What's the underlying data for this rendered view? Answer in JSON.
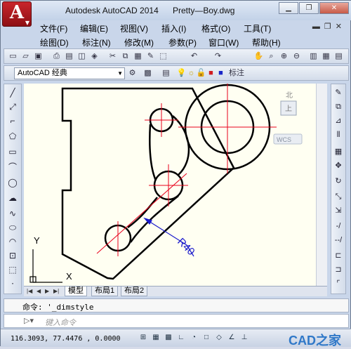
{
  "app": {
    "title": "Autodesk AutoCAD 2014",
    "filename": "Pretty—Boy.dwg",
    "logo_letter": "A"
  },
  "menu_row1": [
    "文件(F)",
    "编辑(E)",
    "视图(V)",
    "插入(I)",
    "格式(O)",
    "工具(T)"
  ],
  "menu_row2": [
    "绘图(D)",
    "标注(N)",
    "修改(M)",
    "参数(P)",
    "窗口(W)",
    "帮助(H)"
  ],
  "toolbar2": {
    "workspace": "AutoCAD 经典",
    "dimstyle": "标注"
  },
  "viewcube": {
    "north": "北",
    "top": "上",
    "wcs": "WCS"
  },
  "ucs": {
    "x_label": "X",
    "y_label": "Y"
  },
  "dimension": {
    "label": "R40"
  },
  "layout_tabs": [
    "模型",
    "布局1",
    "布局2"
  ],
  "command": {
    "history": "命令: '_dimstyle",
    "placeholder": "键入命令"
  },
  "status": {
    "coords": "116.3093, 77.4476 , 0.0000",
    "watermark": "CAD之家"
  },
  "colors": {
    "geometry": "#000000",
    "centerline": "#e8001c",
    "dimension": "#1a1acc",
    "canvas": "#fffff2"
  }
}
